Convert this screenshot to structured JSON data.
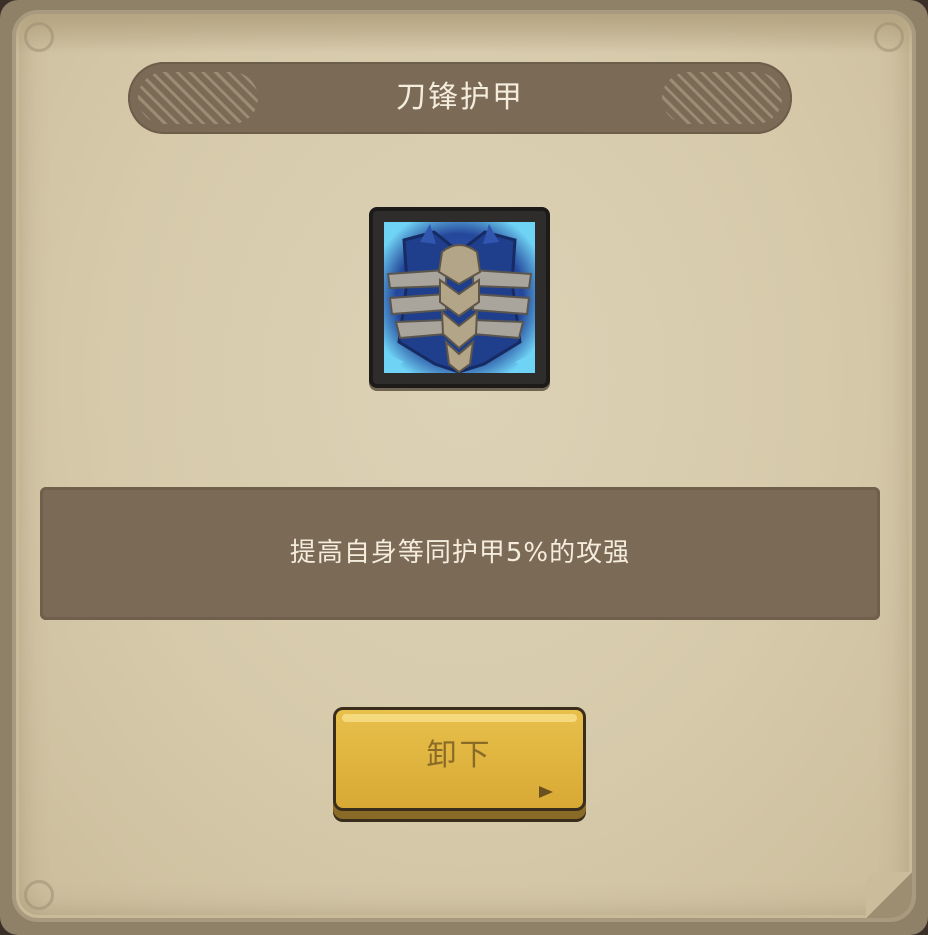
{
  "dialog": {
    "title": "刀锋护甲",
    "item_icon": "blade-armor-icon",
    "description": "提高自身等同护甲5%的攻强",
    "unequip_label": "卸下"
  },
  "colors": {
    "parchment": "#d6caab",
    "banner": "#7b6a56",
    "text_light": "#f4ecdc",
    "button_gold": "#e0b540",
    "button_text": "#8a6a27",
    "item_blue": "#2a4c9a",
    "item_glow": "#6fd3f5"
  }
}
